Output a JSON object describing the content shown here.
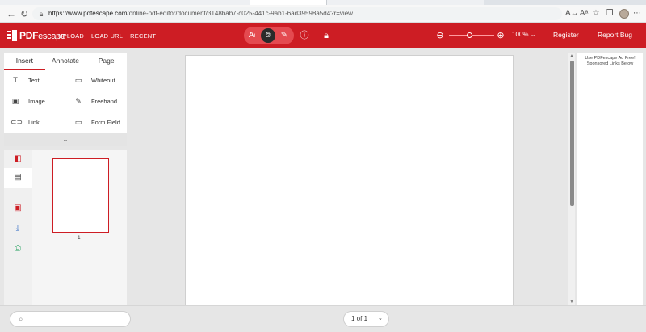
{
  "browser": {
    "url_host": "https://www.pdfescape.com",
    "url_path": "/online-pdf-editor/document/3148bab7-c025-441c-9ab1-6ad39598a5d4?r=view",
    "icons": [
      "back-icon",
      "reload-icon",
      "lock-icon",
      "translate-icon",
      "read-aloud-icon",
      "favorite-icon",
      "collections-icon",
      "profile-avatar"
    ]
  },
  "header": {
    "logo_main": "PDF",
    "logo_sub": "escape",
    "nav": [
      "UPLOAD",
      "LOAD URL",
      "RECENT"
    ],
    "zoom_percent": "100%",
    "zoom_level": 0.4,
    "register_label": "Register",
    "report_bug_label": "Report Bug",
    "brand_color": "#cd1d24"
  },
  "left_panel": {
    "tabs": [
      "Insert",
      "Annotate",
      "Page"
    ],
    "active_tab": "Insert",
    "tools": [
      {
        "label": "Text",
        "icon": "text-icon"
      },
      {
        "label": "Whiteout",
        "icon": "whiteout-icon"
      },
      {
        "label": "Image",
        "icon": "image-icon"
      },
      {
        "label": "Freehand",
        "icon": "pencil-icon"
      },
      {
        "label": "Link",
        "icon": "link-icon"
      },
      {
        "label": "Form Field",
        "icon": "form-field-icon"
      }
    ],
    "thumbnail_page_number": "1"
  },
  "ad": {
    "line1": "Use PDFescape Ad Free!",
    "line2": "Sponsored Links Below"
  },
  "footer": {
    "search_placeholder": "",
    "page_indicator": "1 of 1"
  }
}
